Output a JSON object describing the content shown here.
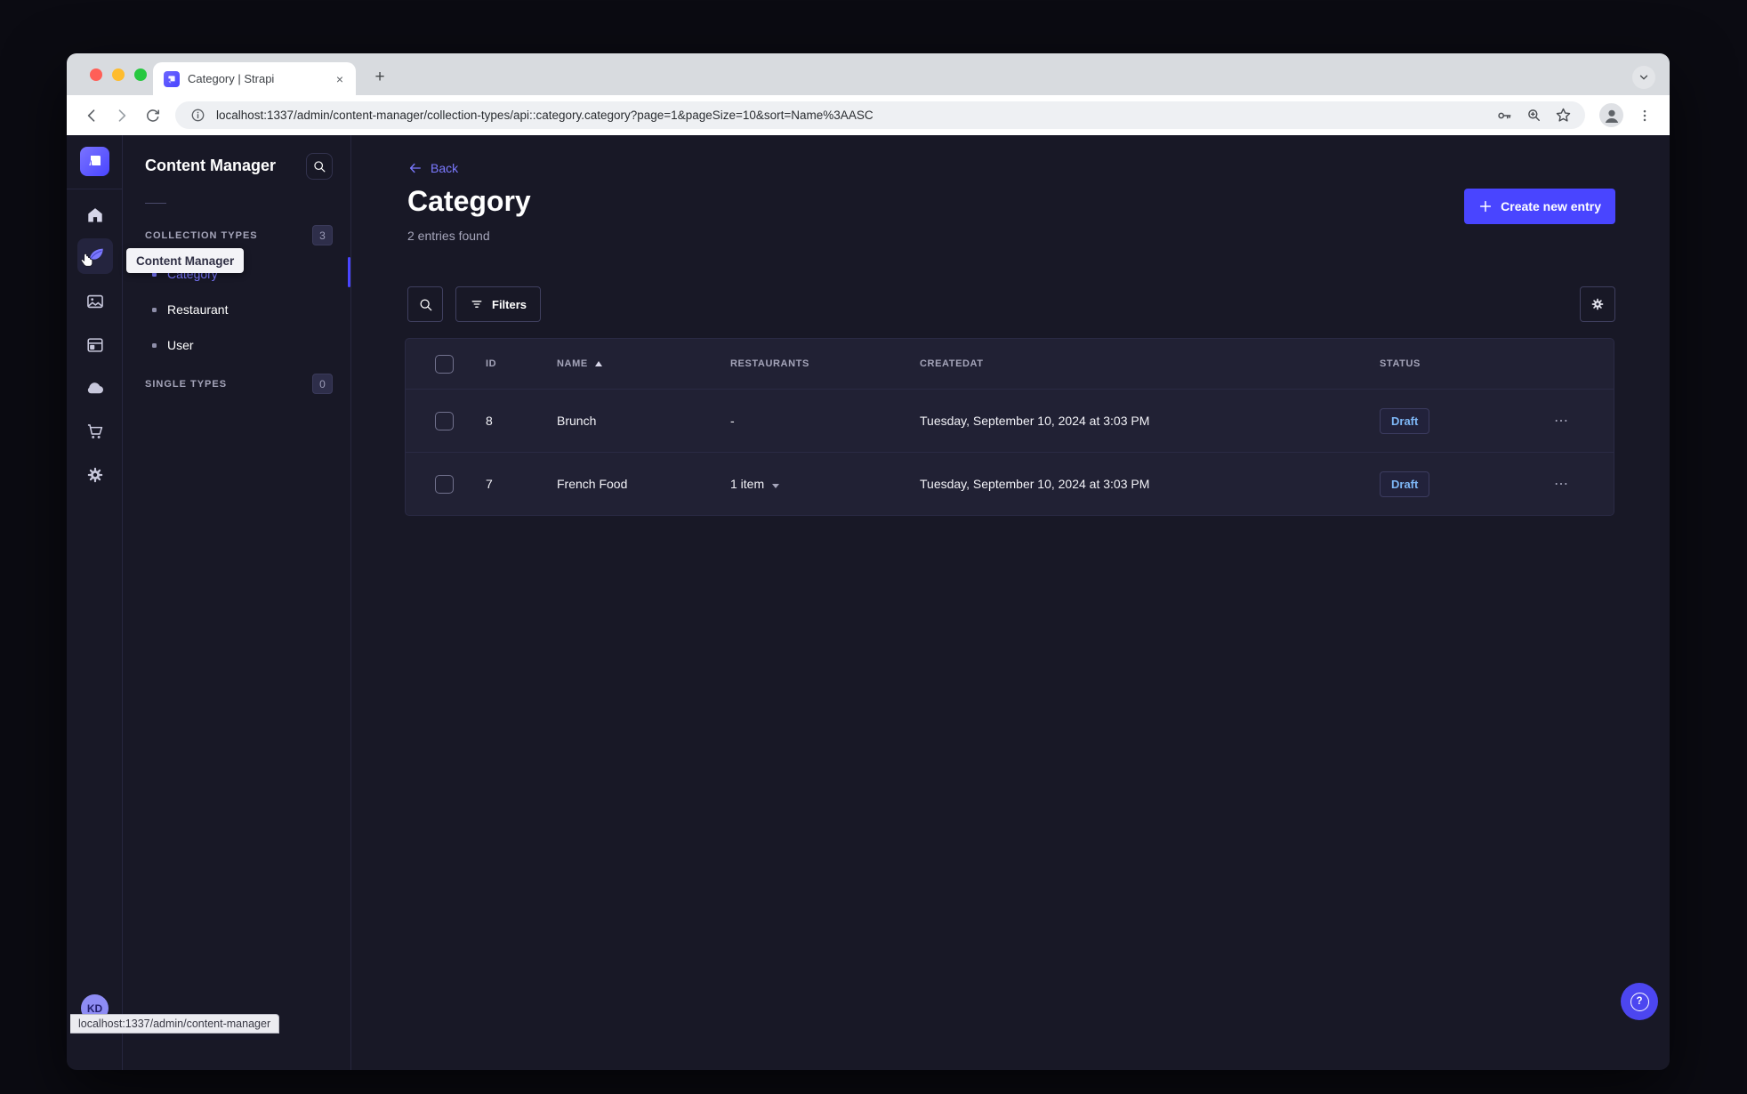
{
  "browser": {
    "tab_title": "Category | Strapi",
    "close_tab_glyph": "×",
    "new_tab_glyph": "+",
    "url": "localhost:1337/admin/content-manager/collection-types/api::category.category?page=1&pageSize=10&sort=Name%3AASC"
  },
  "rail": {
    "avatar_initials": "KD"
  },
  "subnav": {
    "title": "Content Manager",
    "collection_types": {
      "label": "COLLECTION TYPES",
      "count": "3"
    },
    "single_types": {
      "label": "SINGLE TYPES",
      "count": "0"
    },
    "items": [
      {
        "label": "Category",
        "active": true
      },
      {
        "label": "Restaurant",
        "active": false
      },
      {
        "label": "User",
        "active": false
      }
    ]
  },
  "tooltip_text": "Content Manager",
  "status_link": "localhost:1337/admin/content-manager",
  "page": {
    "back_label": "Back",
    "title": "Category",
    "subtitle": "2 entries found",
    "create_button_label": "Create new entry",
    "filters_button_label": "Filters",
    "help_glyph": "?"
  },
  "table": {
    "headers": {
      "id": "ID",
      "name": "NAME",
      "restaurants": "RESTAURANTS",
      "createdat": "CREATEDAT",
      "status": "STATUS"
    },
    "sort": {
      "column": "NAME",
      "direction": "ascending"
    },
    "row_actions_glyph": "⋯",
    "rows": [
      {
        "id": "8",
        "name": "Brunch",
        "restaurants": "-",
        "createdat": "Tuesday, September 10, 2024 at 3:03 PM",
        "status": "Draft"
      },
      {
        "id": "7",
        "name": "French Food",
        "restaurants": "1 item",
        "createdat": "Tuesday, September 10, 2024 at 3:03 PM",
        "status": "Draft"
      }
    ]
  },
  "colors": {
    "accent": "#4945ff",
    "accent_light": "#7b79ff",
    "draft_text": "#7db6f5",
    "page_background": "#181826",
    "panel_background": "#212134"
  }
}
